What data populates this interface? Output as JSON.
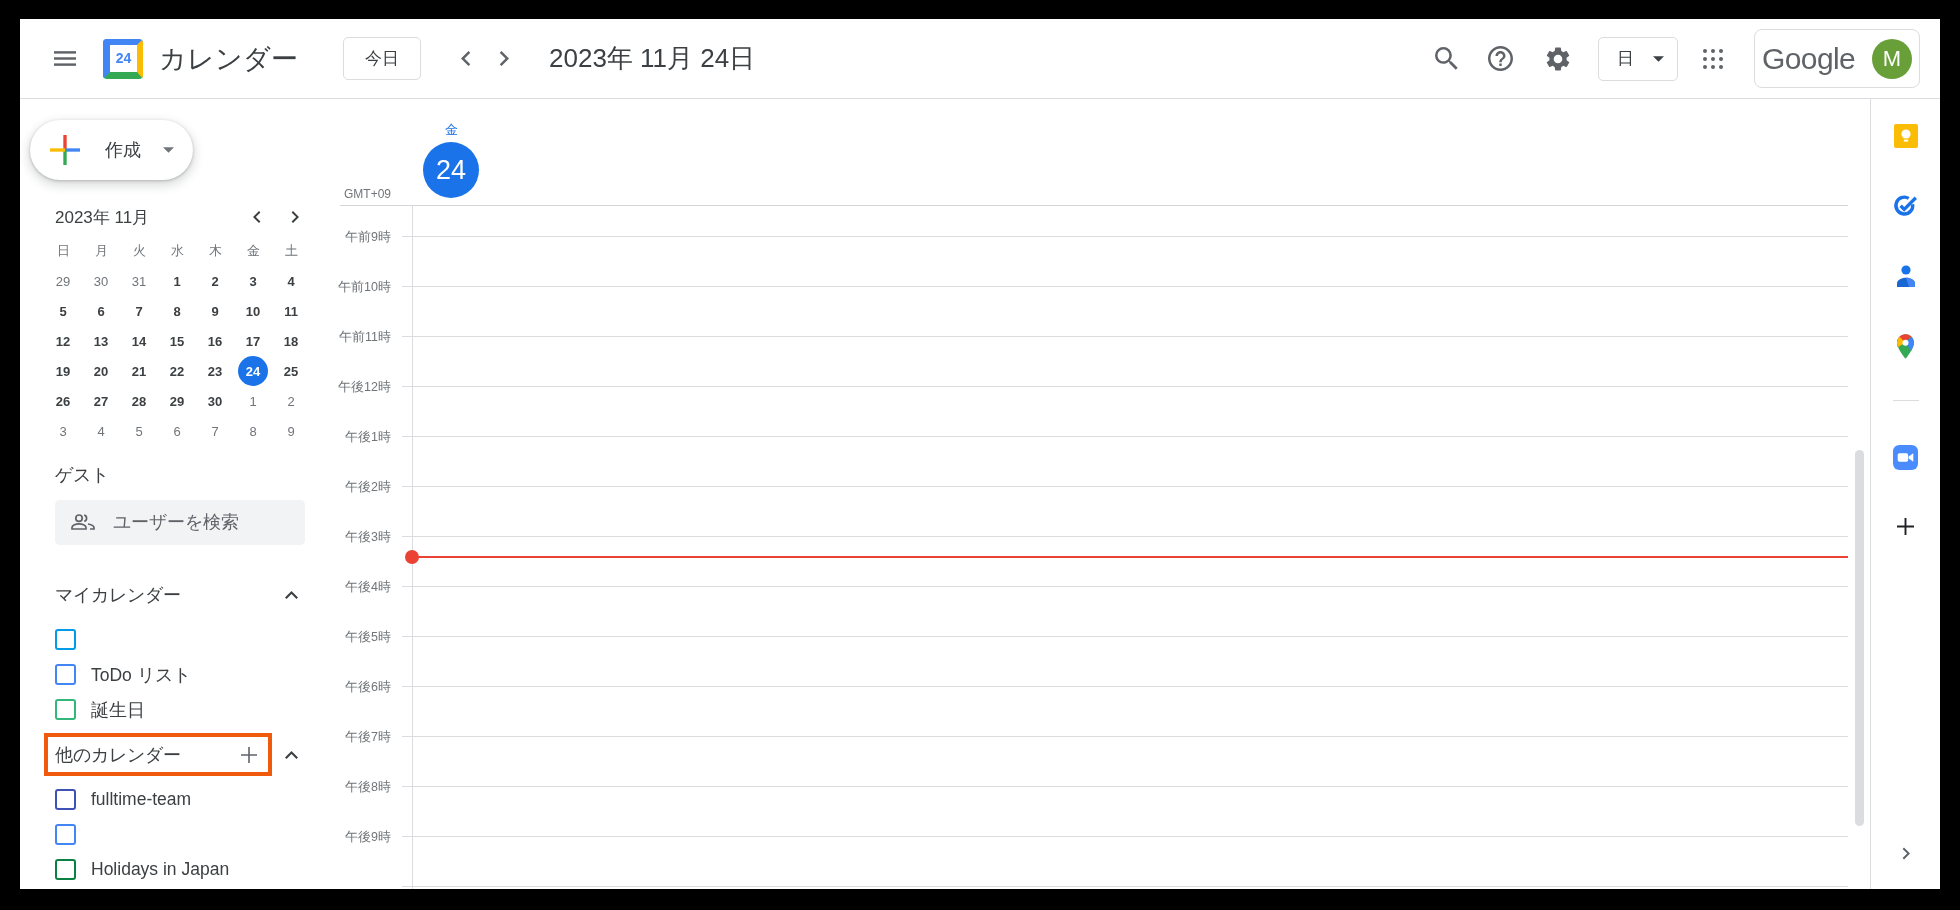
{
  "header": {
    "logo_day": "24",
    "app_name": "カレンダー",
    "today_button": "今日",
    "date_title": "2023年 11月 24日",
    "view_dropdown": "日",
    "account": {
      "brand": "Google",
      "avatar_initial": "M"
    }
  },
  "sidebar": {
    "create_button": "作成",
    "mini_calendar": {
      "title": "2023年 11月",
      "weekdays": [
        "日",
        "月",
        "火",
        "水",
        "木",
        "金",
        "土"
      ],
      "weeks": [
        [
          {
            "day": "29",
            "outside_month": true,
            "selected": false
          },
          {
            "day": "30",
            "outside_month": true,
            "selected": false
          },
          {
            "day": "31",
            "outside_month": true,
            "selected": false
          },
          {
            "day": "1",
            "outside_month": false,
            "selected": false
          },
          {
            "day": "2",
            "outside_month": false,
            "selected": false
          },
          {
            "day": "3",
            "outside_month": false,
            "selected": false
          },
          {
            "day": "4",
            "outside_month": false,
            "selected": false
          }
        ],
        [
          {
            "day": "5",
            "outside_month": false,
            "selected": false
          },
          {
            "day": "6",
            "outside_month": false,
            "selected": false
          },
          {
            "day": "7",
            "outside_month": false,
            "selected": false
          },
          {
            "day": "8",
            "outside_month": false,
            "selected": false
          },
          {
            "day": "9",
            "outside_month": false,
            "selected": false
          },
          {
            "day": "10",
            "outside_month": false,
            "selected": false
          },
          {
            "day": "11",
            "outside_month": false,
            "selected": false
          }
        ],
        [
          {
            "day": "12",
            "outside_month": false,
            "selected": false
          },
          {
            "day": "13",
            "outside_month": false,
            "selected": false
          },
          {
            "day": "14",
            "outside_month": false,
            "selected": false
          },
          {
            "day": "15",
            "outside_month": false,
            "selected": false
          },
          {
            "day": "16",
            "outside_month": false,
            "selected": false
          },
          {
            "day": "17",
            "outside_month": false,
            "selected": false
          },
          {
            "day": "18",
            "outside_month": false,
            "selected": false
          }
        ],
        [
          {
            "day": "19",
            "outside_month": false,
            "selected": false
          },
          {
            "day": "20",
            "outside_month": false,
            "selected": false
          },
          {
            "day": "21",
            "outside_month": false,
            "selected": false
          },
          {
            "day": "22",
            "outside_month": false,
            "selected": false
          },
          {
            "day": "23",
            "outside_month": false,
            "selected": false
          },
          {
            "day": "24",
            "outside_month": false,
            "selected": true
          },
          {
            "day": "25",
            "outside_month": false,
            "selected": false
          }
        ],
        [
          {
            "day": "26",
            "outside_month": false,
            "selected": false
          },
          {
            "day": "27",
            "outside_month": false,
            "selected": false
          },
          {
            "day": "28",
            "outside_month": false,
            "selected": false
          },
          {
            "day": "29",
            "outside_month": false,
            "selected": false
          },
          {
            "day": "30",
            "outside_month": false,
            "selected": false
          },
          {
            "day": "1",
            "outside_month": true,
            "selected": false
          },
          {
            "day": "2",
            "outside_month": true,
            "selected": false
          }
        ],
        [
          {
            "day": "3",
            "outside_month": true,
            "selected": false
          },
          {
            "day": "4",
            "outside_month": true,
            "selected": false
          },
          {
            "day": "5",
            "outside_month": true,
            "selected": false
          },
          {
            "day": "6",
            "outside_month": true,
            "selected": false
          },
          {
            "day": "7",
            "outside_month": true,
            "selected": false
          },
          {
            "day": "8",
            "outside_month": true,
            "selected": false
          },
          {
            "day": "9",
            "outside_month": true,
            "selected": false
          }
        ]
      ]
    },
    "guests": {
      "title": "ゲスト",
      "search": {
        "placeholder": "ユーザーを検索"
      }
    },
    "calendar_sections": [
      {
        "title": "マイカレンダー",
        "expanded": true,
        "highlighted": false,
        "add_button": false,
        "items": [
          {
            "checked": false,
            "color": "#039be5"
          },
          {
            "label": "ToDo リスト",
            "checked": false,
            "color": "#4285f4"
          },
          {
            "label": "誕生日",
            "checked": false,
            "color": "#33b679"
          }
        ]
      },
      {
        "title": "他のカレンダー",
        "expanded": true,
        "highlighted": true,
        "add_button": true,
        "items": [
          {
            "label": "fulltime-team",
            "checked": false,
            "color": "#3f51b5"
          },
          {
            "checked": false,
            "color": "#4285f4"
          },
          {
            "label": "Holidays in Japan",
            "checked": false,
            "color": "#0b8043"
          }
        ]
      }
    ]
  },
  "day_view": {
    "weekday": "金",
    "day": "24",
    "today": true,
    "timezone": "GMT+09",
    "hours": [
      {
        "label": "午前9時",
        "now": false
      },
      {
        "label": "午前10時",
        "now": false
      },
      {
        "label": "午前11時",
        "now": false
      },
      {
        "label": "午後12時",
        "now": false
      },
      {
        "label": "午後1時",
        "now": false
      },
      {
        "label": "午後2時",
        "now": false
      },
      {
        "label": "午後3時",
        "now": true
      },
      {
        "label": "午後4時",
        "now": false
      },
      {
        "label": "午後5時",
        "now": false
      },
      {
        "label": "午後6時",
        "now": false
      },
      {
        "label": "午後7時",
        "now": false
      },
      {
        "label": "午後8時",
        "now": false
      },
      {
        "label": "午後9時",
        "now": false
      }
    ]
  }
}
